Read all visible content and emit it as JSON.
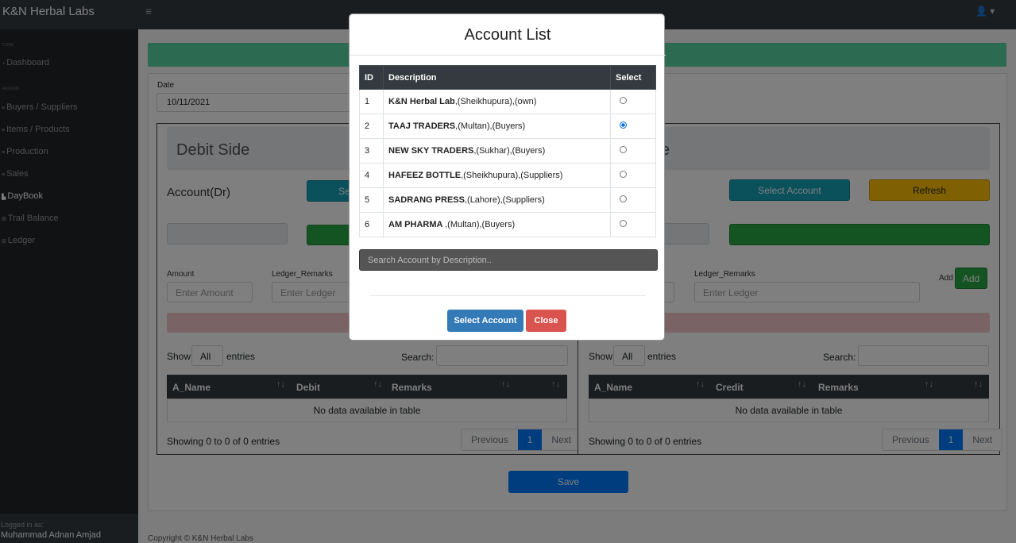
{
  "app": {
    "brand": "K&N Herbal Labs",
    "menu_icon": "hamburger-icon",
    "user_icon": "user-icon"
  },
  "sidebar": {
    "heading_core": "Core",
    "heading_addons": "Addons",
    "items": [
      {
        "label": "Dashboard",
        "icon": "dashboard-icon"
      },
      {
        "label": "Buyers / Suppliers",
        "icon": "users-icon"
      },
      {
        "label": "Items / Products",
        "icon": "box-icon"
      },
      {
        "label": "Production",
        "icon": "factory-icon"
      },
      {
        "label": "Sales",
        "icon": "cart-icon"
      },
      {
        "label": "DayBook",
        "icon": "book-icon"
      },
      {
        "label": "Trail Balance",
        "icon": "table-icon"
      },
      {
        "label": "Ledger",
        "icon": "ledger-icon"
      }
    ],
    "footer_label": "Logged in as:",
    "footer_user": "Muhammad Adnan Amjad"
  },
  "form": {
    "date_label": "Date",
    "date_value": "10/11/2021"
  },
  "debit": {
    "title": "Debit Side",
    "account_label": "Account(Dr)",
    "select_btn": "Se",
    "amount_label": "Amount",
    "amount_placeholder": "Enter Amount",
    "remarks_label": "Ledger_Remarks",
    "remarks_placeholder": "Enter Ledger",
    "show": "Show",
    "entries": "entries",
    "entries_value": "All",
    "search_label": "Search:",
    "columns": [
      "A_Name",
      "Debit",
      "Remarks"
    ],
    "empty": "No data available in table",
    "showing": "Showing 0 to 0 of 0 entries",
    "prev": "Previous",
    "page": "1",
    "next": "Next"
  },
  "credit": {
    "title": "e",
    "select_btn": "Select Account",
    "refresh_btn": "Refresh",
    "remarks_label": "Ledger_Remarks",
    "remarks_placeholder": "Enter Ledger",
    "add_label": "Add",
    "add_btn": "Add",
    "show": "Show",
    "entries": "entries",
    "entries_value": "All",
    "search_label": "Search:",
    "columns": [
      "A_Name",
      "Credit",
      "Remarks"
    ],
    "empty": "No data available in table",
    "showing": "Showing 0 to 0 of 0 entries",
    "prev": "Previous",
    "page": "1",
    "next": "Next"
  },
  "save_btn": "Save",
  "copyright": "Copyright © K&N Herbal Labs",
  "modal": {
    "title": "Account List",
    "columns": [
      "ID",
      "Description",
      "Select"
    ],
    "rows": [
      {
        "id": "1",
        "name": "K&N Herbal Lab",
        "rest": ",(Sheikhupura),(own)",
        "selected": false
      },
      {
        "id": "2",
        "name": "TAAJ TRADERS",
        "rest": ",(Multan),(Buyers)",
        "selected": true
      },
      {
        "id": "3",
        "name": "NEW SKY TRADERS",
        "rest": ",(Sukhar),(Buyers)",
        "selected": false
      },
      {
        "id": "4",
        "name": "HAFEEZ BOTTLE",
        "rest": ",(Sheikhupura),(Suppliers)",
        "selected": false
      },
      {
        "id": "5",
        "name": "SADRANG PRESS",
        "rest": ",(Lahore),(Suppliers)",
        "selected": false
      },
      {
        "id": "6",
        "name": "AM PHARMA ",
        "rest": ",(Multan),(Buyers)",
        "selected": false
      }
    ],
    "search_placeholder": "Search Account by Description..",
    "select_btn": "Select Account",
    "close_btn": "Close",
    "colors": {
      "primary": "#337ab7",
      "danger": "#d9534f"
    }
  }
}
